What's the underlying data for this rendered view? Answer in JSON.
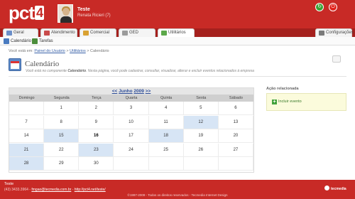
{
  "header": {
    "logo_text": "pct",
    "logo_badge": "4",
    "user_name": "Teste",
    "user_sub": "Renata Ricieri (7)",
    "icons": [
      "refresh-icon",
      "power-icon"
    ]
  },
  "tabs": [
    {
      "label": "Geral",
      "icon": "home-icon"
    },
    {
      "label": "Atendimento",
      "icon": "support-icon"
    },
    {
      "label": "Comercial",
      "icon": "cart-icon"
    },
    {
      "label": "GED",
      "icon": "document-icon"
    },
    {
      "label": "Utilitários",
      "icon": "tools-icon"
    },
    {
      "label": "Configurações",
      "icon": "gear-icon"
    }
  ],
  "subnav": [
    {
      "label": "Calendário",
      "icon": "calendar-icon"
    },
    {
      "label": "Tarefas",
      "icon": "tasks-icon"
    }
  ],
  "breadcrumb": {
    "prefix": "Você está em:",
    "link1": "Painel do Usuário",
    "sep": ">",
    "link2": "Utilitários",
    "current": "Calendário"
  },
  "page": {
    "title": "Calendário",
    "desc_prefix": "Você está no componente",
    "desc_bold": "Calendário",
    "desc_rest": ". Nesta página, você pode cadastrar, consultar, visualizar, alterar e excluir eventos relacionados à empresa"
  },
  "calendar": {
    "prev": "<<",
    "month": "Junho",
    "year": "2009",
    "next": ">>",
    "weekdays": [
      "Domingo",
      "Segunda",
      "Terça",
      "Quarta",
      "Quinta",
      "Sexta",
      "Sábado"
    ],
    "weeks": [
      [
        "",
        "1",
        "2",
        "3",
        "4",
        "5",
        "6"
      ],
      [
        "7",
        "8",
        "9",
        "10",
        "11",
        "12",
        "13"
      ],
      [
        "14",
        "15",
        "16",
        "17",
        "18",
        "19",
        "20"
      ],
      [
        "21",
        "22",
        "23",
        "24",
        "25",
        "26",
        "27"
      ],
      [
        "28",
        "29",
        "30",
        "",
        "",
        "",
        ""
      ]
    ],
    "highlighted": [
      "12",
      "15",
      "18",
      "21",
      "23",
      "28"
    ],
    "today": "16",
    "highlight_color": "#d7e5f5"
  },
  "aside": {
    "title": "Ação relacionada",
    "action": "Incluir evento"
  },
  "footer": {
    "line1": "Teste",
    "phone": "(43) 3433.3964 -",
    "email": "fmgao@tecmedia.com.br",
    "sep": " - ",
    "site": "http://pct4.net/teste/",
    "copyright": "©1997-2009 - Todos os direitos reservados - Tecmedia Internet Design",
    "brand": "tecmedia"
  },
  "colors": {
    "brand": "#c82a26",
    "link": "#3a62a8",
    "action_green": "#43a33e"
  }
}
